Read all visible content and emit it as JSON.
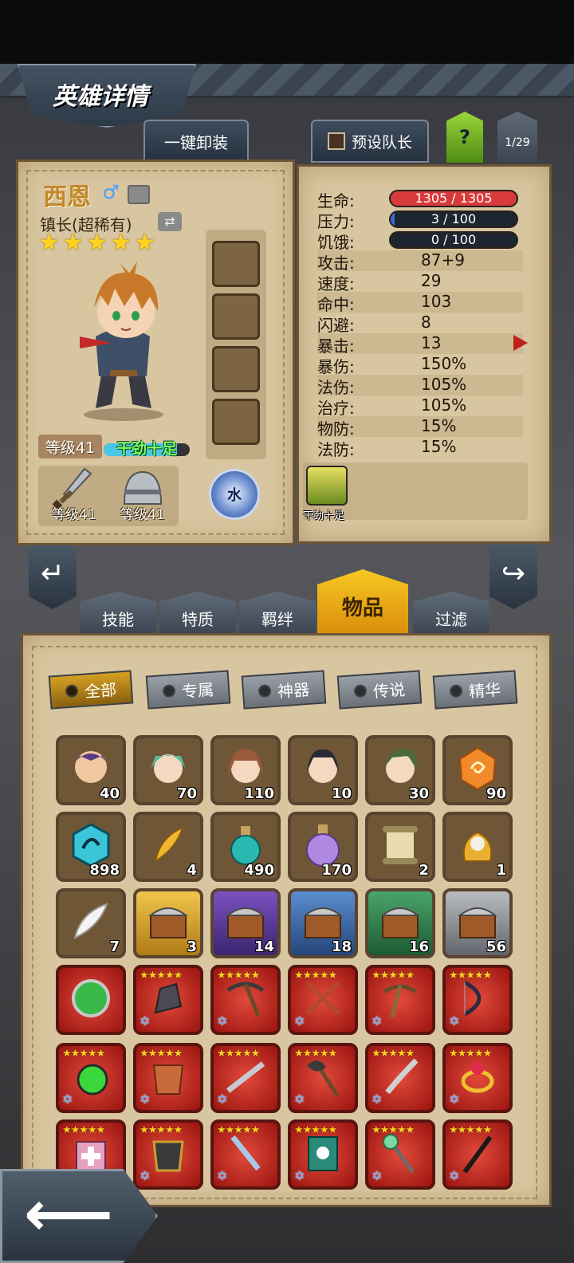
{
  "header": {
    "title": "英雄详情"
  },
  "actions": {
    "unequip_all": "一键卸装",
    "preset_leader": "预设队长",
    "help": "?",
    "page": "1/29"
  },
  "hero": {
    "name": "西恩",
    "gender_icon": "male-icon",
    "class": "镇长(超稀有)",
    "stars": 5,
    "level": "等级41",
    "mood": "干劲十足",
    "mood_level": 0.85,
    "weapon_level": "等级41",
    "armor_level": "等级41",
    "element": "水"
  },
  "stats": {
    "hp": {
      "label": "生命:",
      "value": "1305 / 1305",
      "fraction": 1.0,
      "color": "#d63a3a"
    },
    "stress": {
      "label": "压力:",
      "value": "3 / 100",
      "fraction": 0.03,
      "color": "#3a6ad6"
    },
    "hunger": {
      "label": "饥饿:",
      "value": "0 / 100",
      "fraction": 0.0,
      "color": "#3a6ad6"
    },
    "rows": [
      {
        "label": "攻击:",
        "value": "87+9"
      },
      {
        "label": "速度:",
        "value": "29"
      },
      {
        "label": "命中:",
        "value": "103"
      },
      {
        "label": "闪避:",
        "value": "8"
      },
      {
        "label": "暴击:",
        "value": "13"
      },
      {
        "label": "暴伤:",
        "value": "150%"
      },
      {
        "label": "法伤:",
        "value": "105%"
      },
      {
        "label": "治疗:",
        "value": "105%"
      },
      {
        "label": "物防:",
        "value": "15%"
      },
      {
        "label": "法防:",
        "value": "15%"
      }
    ],
    "trait_label": "干劲十足"
  },
  "tabs": [
    "技能",
    "特质",
    "羁绊",
    "物品",
    "过滤"
  ],
  "active_tab": "物品",
  "filters": [
    "全部",
    "专属",
    "神器",
    "传说",
    "精华"
  ],
  "active_filter": "全部",
  "inventory": {
    "row1": [
      {
        "icon": "hero-shard-warrior-icon",
        "count": "40"
      },
      {
        "icon": "hero-shard-priestess-icon",
        "count": "70"
      },
      {
        "icon": "hero-shard-valkyrie-icon",
        "count": "110"
      },
      {
        "icon": "hero-shard-swordswoman-icon",
        "count": "10"
      },
      {
        "icon": "hero-shard-mage-icon",
        "count": "30"
      },
      {
        "icon": "orange-gem-icon",
        "count": "90"
      }
    ],
    "row2": [
      {
        "icon": "cyan-rune-icon",
        "count": "898"
      },
      {
        "icon": "golden-feather-icon",
        "count": "4"
      },
      {
        "icon": "teal-potion-icon",
        "count": "490"
      },
      {
        "icon": "purple-potion-icon",
        "count": "170"
      },
      {
        "icon": "scroll-icon",
        "count": "2"
      },
      {
        "icon": "skull-pouch-icon",
        "count": "1"
      }
    ],
    "row3": [
      {
        "icon": "white-feather-icon",
        "count": "7"
      },
      {
        "icon": "gold-chest-icon",
        "count": "3"
      },
      {
        "icon": "purple-chest-icon",
        "count": "14"
      },
      {
        "icon": "blue-chest-icon",
        "count": "18"
      },
      {
        "icon": "green-chest-icon",
        "count": "16"
      },
      {
        "icon": "silver-chest-icon",
        "count": "56"
      }
    ],
    "row4": [
      {
        "icon": "green-orb-icon"
      },
      {
        "icon": "iron-gauntlet-icon"
      },
      {
        "icon": "pickaxe-icon"
      },
      {
        "icon": "crossed-blades-icon"
      },
      {
        "icon": "crossbow-icon"
      },
      {
        "icon": "dark-bow-icon"
      }
    ],
    "row5": [
      {
        "icon": "green-flask-icon"
      },
      {
        "icon": "golden-armor-icon"
      },
      {
        "icon": "rifle-icon"
      },
      {
        "icon": "battle-axe-icon"
      },
      {
        "icon": "curved-sword-icon"
      },
      {
        "icon": "ruby-ring-icon"
      }
    ],
    "row6": [
      {
        "icon": "medkit-icon"
      },
      {
        "icon": "spiked-armor-icon"
      },
      {
        "icon": "broadsword-icon"
      },
      {
        "icon": "spellbook-icon"
      },
      {
        "icon": "scepter-icon"
      },
      {
        "icon": "black-staff-icon"
      }
    ]
  }
}
